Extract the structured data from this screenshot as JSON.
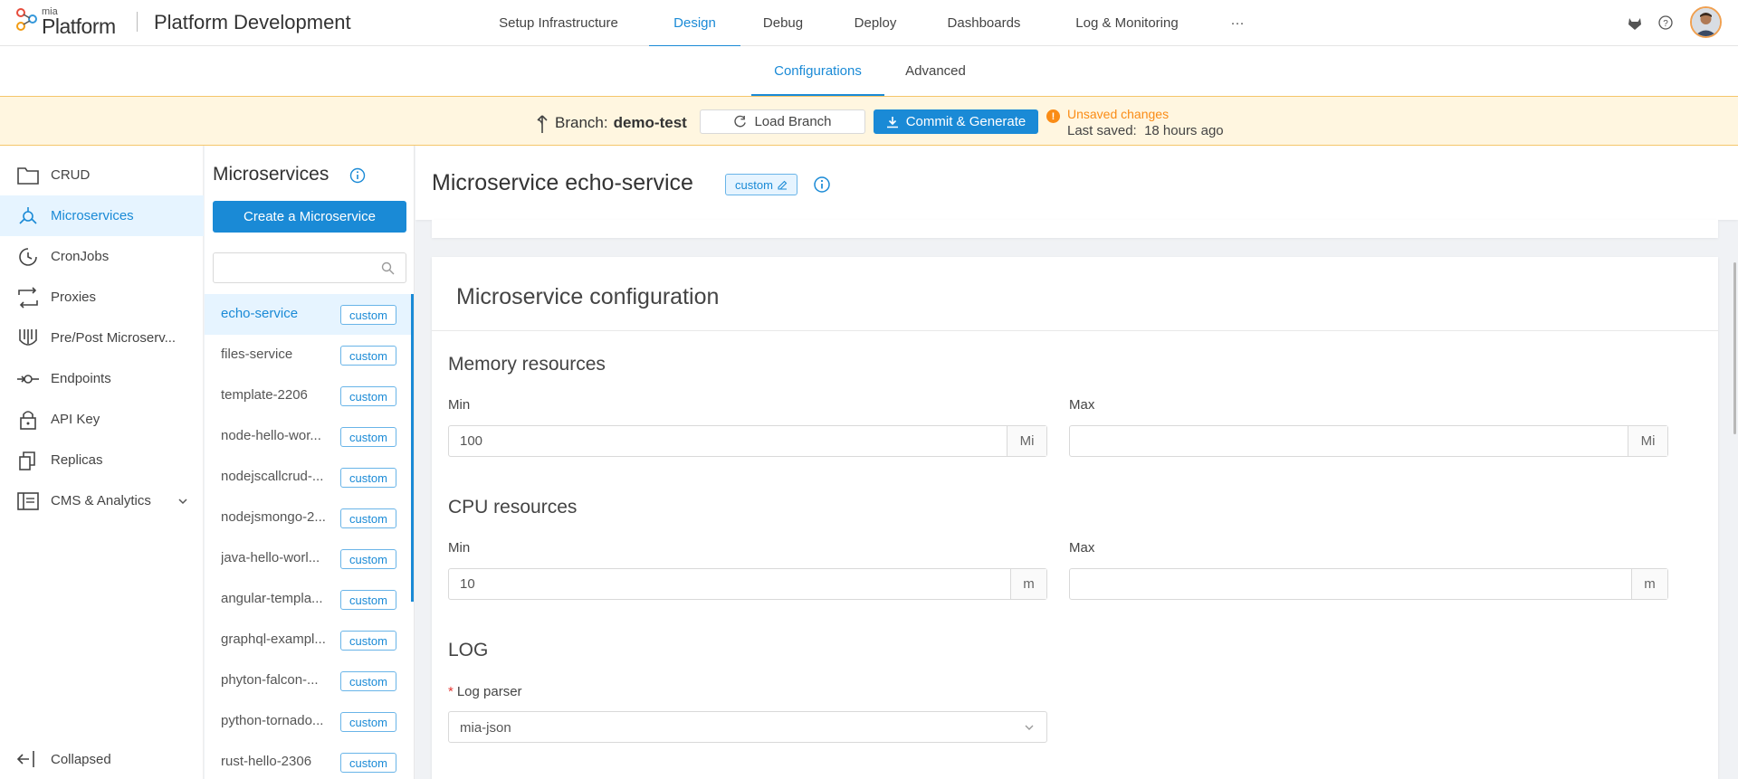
{
  "header": {
    "logo_mia": "mia",
    "logo_word": "Platform",
    "project_title": "Platform Development",
    "nav": [
      {
        "label": "Setup Infrastructure"
      },
      {
        "label": "Design"
      },
      {
        "label": "Debug"
      },
      {
        "label": "Deploy"
      },
      {
        "label": "Dashboards"
      },
      {
        "label": "Log & Monitoring"
      },
      {
        "label": "···"
      }
    ],
    "active_nav": "Design",
    "icons": [
      "gitlab-icon",
      "help-icon",
      "avatar"
    ]
  },
  "subtabs": [
    {
      "label": "Configurations"
    },
    {
      "label": "Advanced"
    }
  ],
  "branch": {
    "label": "Branch:",
    "name": "demo-test",
    "load_button": "Load Branch",
    "commit_button": "Commit & Generate",
    "unsaved_text": "Unsaved changes",
    "last_saved_label": "Last saved:",
    "last_saved_value": "18 hours ago"
  },
  "sidebar": {
    "items": [
      {
        "label": "CRUD",
        "icon": "folder-icon"
      },
      {
        "label": "Microservices",
        "icon": "microservices-icon"
      },
      {
        "label": "CronJobs",
        "icon": "clock-icon"
      },
      {
        "label": "Proxies",
        "icon": "swap-icon"
      },
      {
        "label": "Pre/Post Microserv...",
        "icon": "decorator-icon"
      },
      {
        "label": "Endpoints",
        "icon": "endpoint-icon"
      },
      {
        "label": "API Key",
        "icon": "lock-icon"
      },
      {
        "label": "Replicas",
        "icon": "copy-icon"
      },
      {
        "label": "CMS & Analytics",
        "icon": "cms-icon"
      }
    ],
    "collapsed_label": "Collapsed"
  },
  "microservices_panel": {
    "title": "Microservices",
    "create_button": "Create a Microservice",
    "search_placeholder": "",
    "items": [
      {
        "name": "echo-service",
        "tag": "custom"
      },
      {
        "name": "files-service",
        "tag": "custom"
      },
      {
        "name": "template-2206",
        "tag": "custom"
      },
      {
        "name": "node-hello-wor...",
        "tag": "custom"
      },
      {
        "name": "nodejscallcrud-...",
        "tag": "custom"
      },
      {
        "name": "nodejsmongo-2...",
        "tag": "custom"
      },
      {
        "name": "java-hello-worl...",
        "tag": "custom"
      },
      {
        "name": "angular-templa...",
        "tag": "custom"
      },
      {
        "name": "graphql-exampl...",
        "tag": "custom"
      },
      {
        "name": "phyton-falcon-...",
        "tag": "custom"
      },
      {
        "name": "python-tornado...",
        "tag": "custom"
      },
      {
        "name": "rust-hello-2306",
        "tag": "custom"
      }
    ]
  },
  "main": {
    "title": "Microservice echo-service",
    "title_tag": "custom",
    "card_title": "Microservice configuration",
    "memory": {
      "heading": "Memory resources",
      "min_label": "Min",
      "min_value": "100",
      "min_unit": "Mi",
      "max_label": "Max",
      "max_value": "",
      "max_unit": "Mi"
    },
    "cpu": {
      "heading": "CPU resources",
      "min_label": "Min",
      "min_value": "10",
      "min_unit": "m",
      "max_label": "Max",
      "max_value": "",
      "max_unit": "m"
    },
    "log": {
      "heading": "LOG",
      "required_mark": "*",
      "parser_label": "Log parser",
      "parser_value": "mia-json"
    }
  },
  "colors": {
    "accent": "#1a8ad6",
    "warning": "#fa8c16",
    "branch_bar_bg": "#fff6e0"
  }
}
